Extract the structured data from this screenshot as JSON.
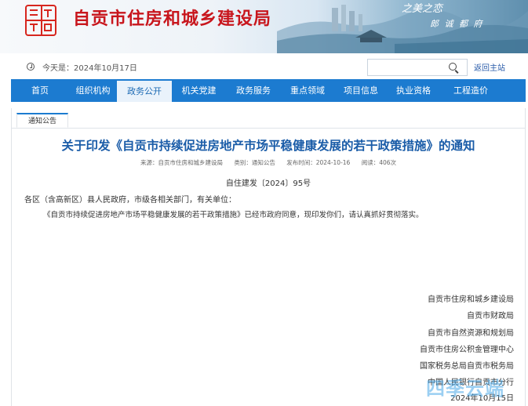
{
  "header": {
    "logo_lines": [
      "建",
      "设",
      "局"
    ],
    "site_title": "自贡市住房和城乡建设局",
    "motto_line1": "之美之恋",
    "motto_line2": "郎 诚 都 府"
  },
  "topbar": {
    "date_text": "今天是：2024年10月17日",
    "search": {
      "value": "",
      "placeholder": ""
    },
    "home_link": "返回主站"
  },
  "nav": {
    "active_index": 2,
    "items": [
      "首页",
      "组织机构",
      "政务公开",
      "机关党建",
      "政务服务",
      "重点领域",
      "项目信息",
      "执业资格",
      "工程造价"
    ]
  },
  "article": {
    "tab_label": "通知公告",
    "title": "关于印发《自贡市持续促进房地产市场平稳健康发展的若干政策措施》的通知",
    "meta": {
      "source": "来源：自贡市住房和城乡建设局",
      "category": "类别：通知公告",
      "published": "发布时间：2024-10-16",
      "views": "阅读：406次"
    },
    "doc_number": "自住建发〔2024〕95号",
    "salutation": "各区（含高新区）县人民政府，市级各相关部门，有关单位：",
    "body": "《自贡市持续促进房地产市场平稳健康发展的若干政策措施》已经市政府同意，现印发你们，请认真抓好贯彻落实。",
    "signatories": [
      "自贡市住房和城乡建设局",
      "自贡市财政局",
      "自贡市自然资源和规划局",
      "自贡市住房公积金管理中心",
      "国家税务总局自贡市税务局",
      "中国人民银行自贡市分行"
    ],
    "sign_date": "2024年10月15日"
  },
  "watermark": "四季云端",
  "colors": {
    "nav_bg": "#1c7bd0",
    "title_red": "#c8161d",
    "article_title_blue": "#1a5ca8"
  }
}
